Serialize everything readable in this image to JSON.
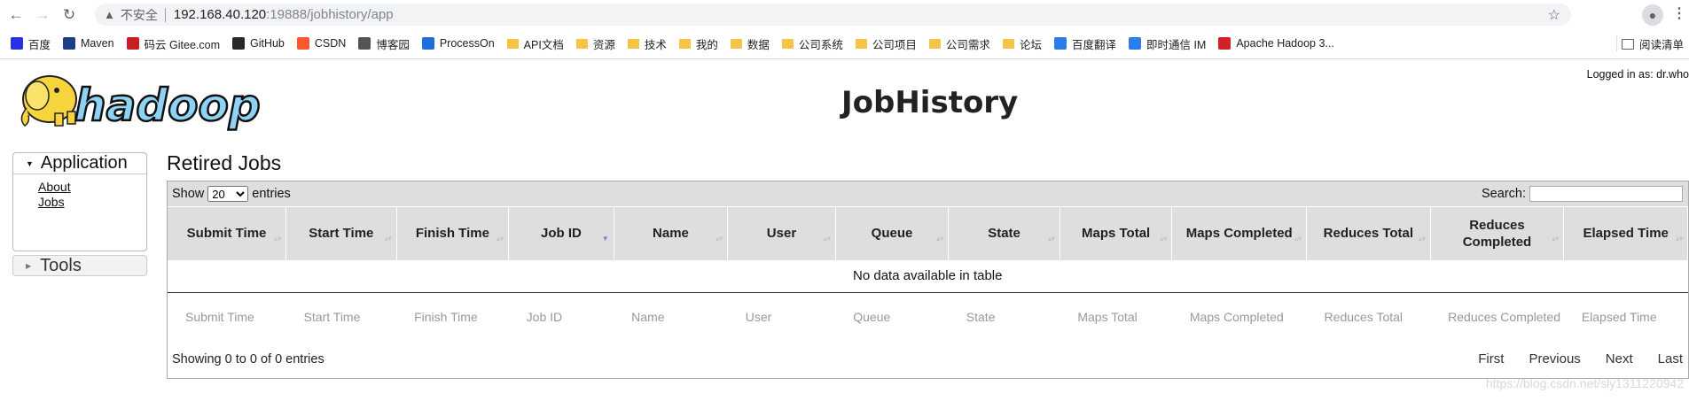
{
  "browser": {
    "security_text": "不安全",
    "url_host": "192.168.40.120",
    "url_path": ":19888/jobhistory/app",
    "bookmarks": [
      {
        "label": "百度",
        "icon": "paw-icon",
        "color": "#2932e1"
      },
      {
        "label": "Maven",
        "icon": "mvn-icon",
        "color": "#1a3f88"
      },
      {
        "label": "码云 Gitee.com",
        "icon": "gitee-icon",
        "color": "#c71d23"
      },
      {
        "label": "GitHub",
        "icon": "github-icon",
        "color": "#24292e"
      },
      {
        "label": "CSDN",
        "icon": "csdn-icon",
        "color": "#fc5531"
      },
      {
        "label": "博客园",
        "icon": "cnblogs-icon",
        "color": "#555555"
      },
      {
        "label": "ProcessOn",
        "icon": "processon-icon",
        "color": "#1e6fd9"
      },
      {
        "label": "API文档",
        "icon": "folder-icon",
        "color": "#f6c445"
      },
      {
        "label": "资源",
        "icon": "folder-icon",
        "color": "#f6c445"
      },
      {
        "label": "技术",
        "icon": "folder-icon",
        "color": "#f6c445"
      },
      {
        "label": "我的",
        "icon": "folder-icon",
        "color": "#f6c445"
      },
      {
        "label": "数据",
        "icon": "folder-icon",
        "color": "#f6c445"
      },
      {
        "label": "公司系统",
        "icon": "folder-icon",
        "color": "#f6c445"
      },
      {
        "label": "公司项目",
        "icon": "folder-icon",
        "color": "#f6c445"
      },
      {
        "label": "公司需求",
        "icon": "folder-icon",
        "color": "#f6c445"
      },
      {
        "label": "论坛",
        "icon": "folder-icon",
        "color": "#f6c445"
      },
      {
        "label": "百度翻译",
        "icon": "translate-icon",
        "color": "#2b7de9"
      },
      {
        "label": "即时通信 IM",
        "icon": "cloud-icon",
        "color": "#2b7de9"
      },
      {
        "label": "Apache Hadoop 3...",
        "icon": "feather-icon",
        "color": "#d22128"
      }
    ],
    "reading_list": "阅读清单"
  },
  "header": {
    "title": "JobHistory",
    "logged_in": "Logged in as: dr.who",
    "logo_text": "hadoop"
  },
  "sidebar": {
    "application_label": "Application",
    "links": [
      "About",
      "Jobs"
    ],
    "tools_label": "Tools"
  },
  "main": {
    "section_title": "Retired Jobs",
    "show_label": "Show",
    "entries_label": "entries",
    "page_size": "20",
    "search_label": "Search:",
    "columns": [
      "Submit Time",
      "Start Time",
      "Finish Time",
      "Job ID",
      "Name",
      "User",
      "Queue",
      "State",
      "Maps Total",
      "Maps Completed",
      "Reduces Total",
      "Reduces Completed",
      "Elapsed Time"
    ],
    "empty_message": "No data available in table",
    "info": "Showing 0 to 0 of 0 entries",
    "pager": [
      "First",
      "Previous",
      "Next",
      "Last"
    ]
  },
  "watermark": "https://blog.csdn.net/sly1311220942"
}
